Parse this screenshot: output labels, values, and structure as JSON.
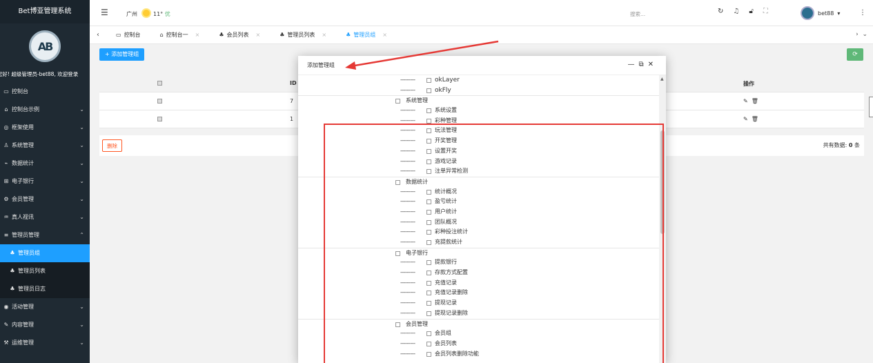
{
  "app": {
    "title": "Bet博亚管理系统",
    "logo_text": "AB"
  },
  "sidebar": {
    "welcome": "您好! 超级管理员-bet88, 欢迎登录",
    "items": [
      {
        "label": "控制台",
        "icon": "monitor-icon",
        "has_sub": false
      },
      {
        "label": "控制台示例",
        "icon": "home-icon",
        "has_sub": true
      },
      {
        "label": "框架使用",
        "icon": "compass-icon",
        "has_sub": true
      },
      {
        "label": "系统管理",
        "icon": "user-icon",
        "has_sub": true
      },
      {
        "label": "数据统计",
        "icon": "chart-icon",
        "has_sub": true
      },
      {
        "label": "电子银行",
        "icon": "bank-icon",
        "has_sub": true
      },
      {
        "label": "会员管理",
        "icon": "gear-icon",
        "has_sub": true
      },
      {
        "label": "真人视讯",
        "icon": "video-icon",
        "has_sub": true
      },
      {
        "label": "管理员管理",
        "icon": "admin-icon",
        "has_sub": true,
        "expanded": true
      }
    ],
    "sub_items": [
      {
        "label": "管理员组",
        "active": true
      },
      {
        "label": "管理员列表",
        "active": false
      },
      {
        "label": "管理员日志",
        "active": false
      }
    ],
    "items_after": [
      {
        "label": "活动管理",
        "icon": "activity-icon"
      },
      {
        "label": "内容管理",
        "icon": "content-icon"
      },
      {
        "label": "运维管理",
        "icon": "ops-icon"
      }
    ]
  },
  "topbar": {
    "city": "广州",
    "temp": "11°",
    "quality": "优",
    "search_placeholder": "搜索...",
    "username": "bet88"
  },
  "tabs": [
    {
      "label": "控制台",
      "icon": "monitor-icon",
      "closable": false,
      "active": false
    },
    {
      "label": "控制台一",
      "icon": "home-icon",
      "closable": true,
      "active": false
    },
    {
      "label": "会员列表",
      "icon": "tree-icon",
      "closable": true,
      "active": false
    },
    {
      "label": "管理员列表",
      "icon": "tree-icon",
      "closable": true,
      "active": false
    },
    {
      "label": "管理员组",
      "icon": "tree-icon",
      "closable": true,
      "active": true
    }
  ],
  "content": {
    "add_button": "+ 添加管理组",
    "table": {
      "headers": {
        "id": "ID",
        "op": "操作"
      },
      "rows": [
        {
          "id": "7"
        },
        {
          "id": "1"
        }
      ]
    },
    "delete_button": "删除",
    "total_label": "共有数据:",
    "total_count": "0",
    "total_unit": "条"
  },
  "modal": {
    "title": "添加管理组",
    "tree": [
      {
        "type": "child",
        "label": "okLayer"
      },
      {
        "type": "child",
        "label": "okFly"
      },
      {
        "type": "group",
        "label": "系统管理"
      },
      {
        "type": "child",
        "label": "系统设置"
      },
      {
        "type": "child",
        "label": "彩种管理"
      },
      {
        "type": "child",
        "label": "玩法管理"
      },
      {
        "type": "child",
        "label": "开奖管理"
      },
      {
        "type": "child",
        "label": "设置开奖"
      },
      {
        "type": "child",
        "label": "游戏记录"
      },
      {
        "type": "child",
        "label": "注单异常检测"
      },
      {
        "type": "group",
        "label": "数据统计"
      },
      {
        "type": "child",
        "label": "统计概况"
      },
      {
        "type": "child",
        "label": "盈亏统计"
      },
      {
        "type": "child",
        "label": "用户统计"
      },
      {
        "type": "child",
        "label": "团队概况"
      },
      {
        "type": "child",
        "label": "彩种投注统计"
      },
      {
        "type": "child",
        "label": "充提款统计"
      },
      {
        "type": "group",
        "label": "电子银行"
      },
      {
        "type": "child",
        "label": "提款银行"
      },
      {
        "type": "child",
        "label": "存款方式配置"
      },
      {
        "type": "child",
        "label": "充值记录"
      },
      {
        "type": "child",
        "label": "充值记录删除"
      },
      {
        "type": "child",
        "label": "提现记录"
      },
      {
        "type": "child",
        "label": "提现记录删除"
      },
      {
        "type": "group",
        "label": "会员管理"
      },
      {
        "type": "child",
        "label": "会员组"
      },
      {
        "type": "child",
        "label": "会员列表"
      },
      {
        "type": "child",
        "label": "会员列表删除功能"
      }
    ],
    "dash": "---------"
  },
  "colors": {
    "accent": "#1e9fff",
    "sidebar_bg": "#1f2a33",
    "danger": "#ff5722",
    "success": "#5fb878",
    "annotation": "#e53935"
  }
}
